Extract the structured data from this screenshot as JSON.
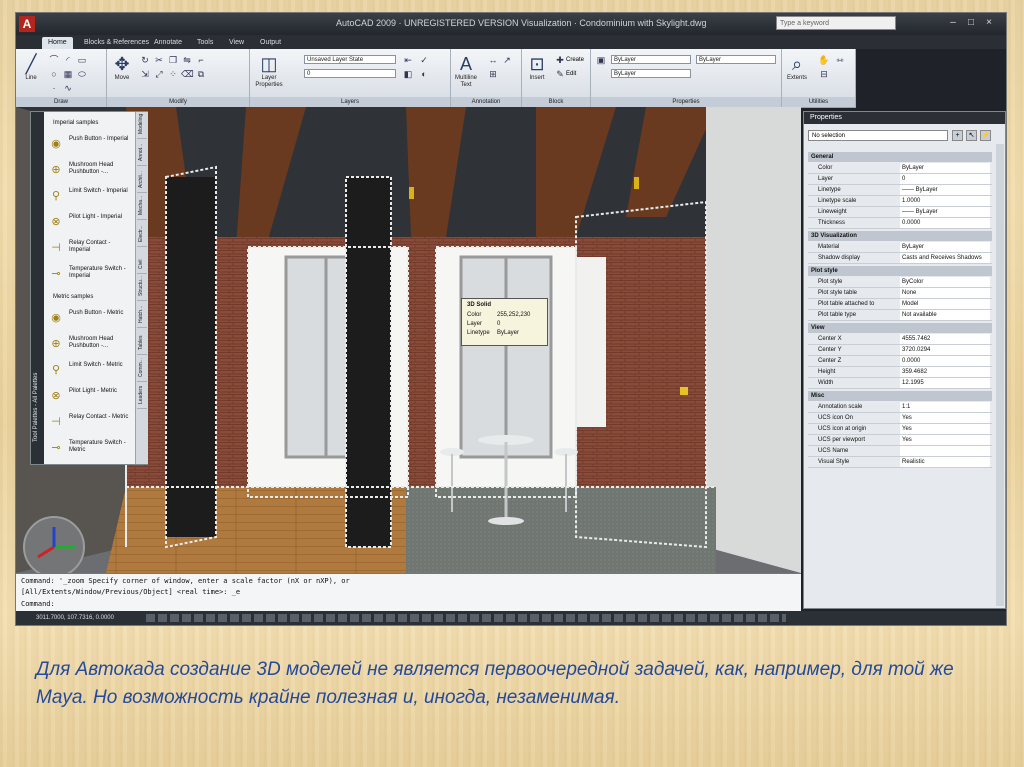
{
  "window": {
    "title": "AutoCAD 2009 · UNREGISTERED VERSION Visualization · Condominium with Skylight.dwg",
    "app_logo": "A",
    "search_placeholder": "Type a keyword",
    "controls": [
      "–",
      "□",
      "×"
    ]
  },
  "ribbon": {
    "tabs": [
      "Home",
      "Blocks & References",
      "Annotate",
      "Tools",
      "View",
      "Output"
    ],
    "active_tab": "Home",
    "panels": {
      "draw": {
        "label": "Draw",
        "line_button": "Line"
      },
      "modify": {
        "label": "Modify",
        "move_button": "Move"
      },
      "layers": {
        "label": "Layers",
        "layer_properties": "Layer Properties",
        "layer_state": "Unsaved Layer State",
        "current_layer": "0"
      },
      "annotation": {
        "label": "Annotation",
        "multiline_text": "Multiline Text"
      },
      "block": {
        "label": "Block",
        "insert": "Insert",
        "create": "Create",
        "edit": "Edit"
      },
      "properties": {
        "label": "Properties",
        "color": "ByLayer",
        "linetype": "ByLayer",
        "lineweight": "ByLayer"
      },
      "utilities": {
        "label": "Utilities",
        "extents": "Extents"
      }
    }
  },
  "tool_palette": {
    "strip_title": "Tool Palettes - All Palettes",
    "side_tabs": [
      "Modeling",
      "Annot...",
      "Archit...",
      "Mecha...",
      "Electr...",
      "Civil",
      "Structu...",
      "Hatch...",
      "Tables",
      "Comm...",
      "Leaders"
    ],
    "imperial_heading": "Imperial samples",
    "imperial_items": [
      "Push Button - Imperial",
      "Mushroom Head Pushbutton -...",
      "Limit Switch - Imperial",
      "Pilot Light - Imperial",
      "Relay Contact - Imperial",
      "Temperature Switch - Imperial"
    ],
    "metric_heading": "Metric samples",
    "metric_items": [
      "Push Button - Metric",
      "Mushroom Head Pushbutton -...",
      "Limit Switch - Metric",
      "Pilot Light - Metric",
      "Relay Contact - Metric",
      "Temperature Switch - Metric"
    ]
  },
  "tooltip": {
    "title": "3D Solid",
    "rows": [
      {
        "k": "Color",
        "v": "255,252,230"
      },
      {
        "k": "Layer",
        "v": "0"
      },
      {
        "k": "Linetype",
        "v": "ByLayer"
      }
    ]
  },
  "properties": {
    "title": "Properties",
    "selection": "No selection",
    "sections": [
      {
        "name": "General",
        "rows": [
          {
            "k": "Color",
            "v": "ByLayer"
          },
          {
            "k": "Layer",
            "v": "0"
          },
          {
            "k": "Linetype",
            "v": "—— ByLayer"
          },
          {
            "k": "Linetype scale",
            "v": "1.0000"
          },
          {
            "k": "Lineweight",
            "v": "—— ByLayer"
          },
          {
            "k": "Thickness",
            "v": "0.0000"
          }
        ]
      },
      {
        "name": "3D Visualization",
        "rows": [
          {
            "k": "Material",
            "v": "ByLayer"
          },
          {
            "k": "Shadow display",
            "v": "Casts and Receives Shadows"
          }
        ]
      },
      {
        "name": "Plot style",
        "rows": [
          {
            "k": "Plot style",
            "v": "ByColor"
          },
          {
            "k": "Plot style table",
            "v": "None"
          },
          {
            "k": "Plot table attached to",
            "v": "Model"
          },
          {
            "k": "Plot table type",
            "v": "Not available"
          }
        ]
      },
      {
        "name": "View",
        "rows": [
          {
            "k": "Center X",
            "v": "4555.7462"
          },
          {
            "k": "Center Y",
            "v": "3720.0294"
          },
          {
            "k": "Center Z",
            "v": "0.0000"
          },
          {
            "k": "Height",
            "v": "359.4682"
          },
          {
            "k": "Width",
            "v": "12.1995"
          }
        ]
      },
      {
        "name": "Misc",
        "rows": [
          {
            "k": "Annotation scale",
            "v": "1:1"
          },
          {
            "k": "UCS icon On",
            "v": "Yes"
          },
          {
            "k": "UCS icon at origin",
            "v": "Yes"
          },
          {
            "k": "UCS per viewport",
            "v": "Yes"
          },
          {
            "k": "UCS Name",
            "v": ""
          },
          {
            "k": "Visual Style",
            "v": "Realistic"
          }
        ]
      }
    ]
  },
  "command_line": {
    "line1": "Command: '_zoom Specify corner of window, enter a scale factor (nX or nXP), or",
    "line2": "[All/Extents/Window/Previous/Object] <real time>: _e",
    "line3": "Command:"
  },
  "status_bar": {
    "coords": "3011.7000, 107.7316, 0.0000"
  },
  "caption": "Для Автокада создание 3D моделей не является первоочередной задачей, как, например, для той же Maya. Но возможность крайне полезная и, иногда, незаменимая.",
  "colors": {
    "caption": "#244a9c",
    "ceiling_beam": "#6a3a20",
    "brick": "#8a4b38",
    "floor_wood": "#b07a3e",
    "floor_carpet": "#707772"
  }
}
